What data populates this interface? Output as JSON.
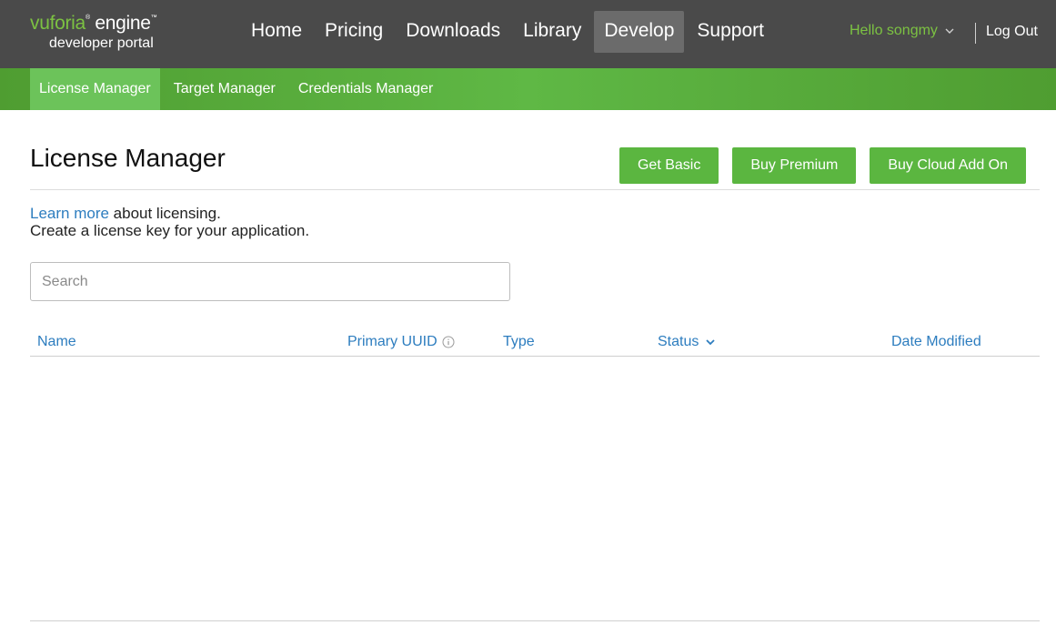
{
  "header": {
    "logo_brand": "vuforia",
    "logo_product": "engine",
    "logo_subtitle": "developer portal",
    "nav": [
      {
        "label": "Home",
        "active": false
      },
      {
        "label": "Pricing",
        "active": false
      },
      {
        "label": "Downloads",
        "active": false
      },
      {
        "label": "Library",
        "active": false
      },
      {
        "label": "Develop",
        "active": true
      },
      {
        "label": "Support",
        "active": false
      }
    ],
    "greeting": "Hello songmy",
    "logout_label": "Log Out"
  },
  "subnav": [
    {
      "label": "License Manager",
      "active": true
    },
    {
      "label": "Target Manager",
      "active": false
    },
    {
      "label": "Credentials Manager",
      "active": false
    }
  ],
  "page": {
    "title": "License Manager",
    "buttons": {
      "get_basic": "Get Basic",
      "buy_premium": "Buy Premium",
      "buy_cloud_add_on": "Buy Cloud Add On"
    },
    "intro_link": "Learn more",
    "intro_rest": " about licensing.",
    "intro_line2": "Create a license key for your application.",
    "search_placeholder": "Search"
  },
  "table": {
    "columns": {
      "name": "Name",
      "primary_uuid": "Primary UUID",
      "type": "Type",
      "status": "Status",
      "date_modified": "Date Modified"
    },
    "sorted_by": "Status",
    "rows": []
  },
  "colors": {
    "header_bg": "#4a4a4a",
    "accent_green": "#5bb640",
    "link_blue": "#2d7dbf",
    "greeting_green": "#7cc242"
  },
  "icons": {
    "info": "info-circle-icon",
    "sort": "chevron-down-icon",
    "user_menu": "chevron-down-icon"
  }
}
